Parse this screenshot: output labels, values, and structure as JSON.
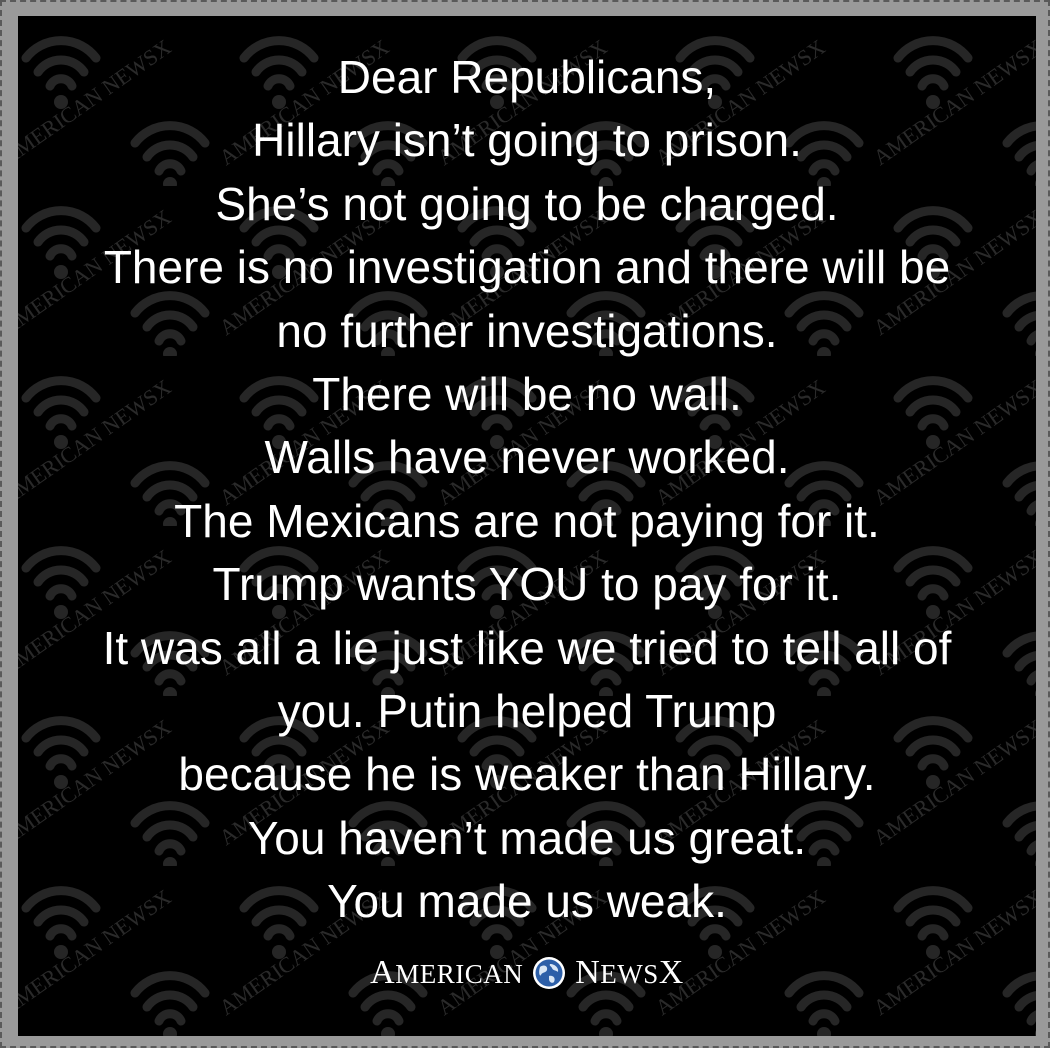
{
  "message": {
    "lines": [
      "Dear Republicans,",
      "Hillary isn’t going to prison.",
      "She’s not going to be charged.",
      "There is no investigation and there will be",
      "no further investigations.",
      "There will be no wall.",
      "Walls have never worked.",
      "The Mexicans are not paying for it.",
      "Trump wants YOU to pay for it.",
      "It was all a lie just like we tried to tell all of",
      "you. Putin helped Trump",
      "because he is weaker than Hillary.",
      "You haven’t made us great.",
      "You made us weak."
    ]
  },
  "logo": {
    "word1_cap": "A",
    "word1_rest": "MERICAN",
    "word2_cap": "N",
    "word2_mid": "EWS",
    "word2_end": "X"
  },
  "watermark": {
    "text": "AMERICAN NEWSX",
    "icon": "wifi-icon"
  },
  "colors": {
    "background": "#000000",
    "text": "#ffffff",
    "watermark": "#2a2a2a",
    "frame": "#9a9a9a"
  }
}
